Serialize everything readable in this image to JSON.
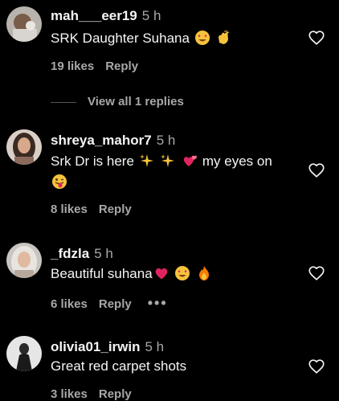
{
  "comments": [
    {
      "username": "mah___eer19",
      "time": "5 h",
      "text": "SRK Daughter Suhana",
      "likes": "19 likes",
      "reply": "Reply",
      "avatar_icon": "profile-photo"
    },
    {
      "username": "shreya_mahor7",
      "time": "5 h",
      "text_line1": "Srk Dr is here",
      "text_line1_tail": "my eyes on",
      "likes": "8 likes",
      "reply": "Reply",
      "avatar_icon": "profile-photo"
    },
    {
      "username": "_fdzla",
      "time": "5 h",
      "text": "Beautiful suhana",
      "likes": "6 likes",
      "reply": "Reply",
      "more_label": "•••",
      "avatar_icon": "profile-photo"
    },
    {
      "username": "olivia01_irwin",
      "time": "5 h",
      "text": "Great red carpet shots",
      "likes": "3 likes",
      "reply": "Reply",
      "avatar_icon": "profile-photo"
    }
  ],
  "view_replies_label": "View all 1 replies",
  "icons": {
    "like": "heart-outline-icon",
    "more": "more-options-icon"
  },
  "colors": {
    "background": "#000000",
    "text": "#f5f5f5",
    "secondary": "#a8a8a8"
  }
}
